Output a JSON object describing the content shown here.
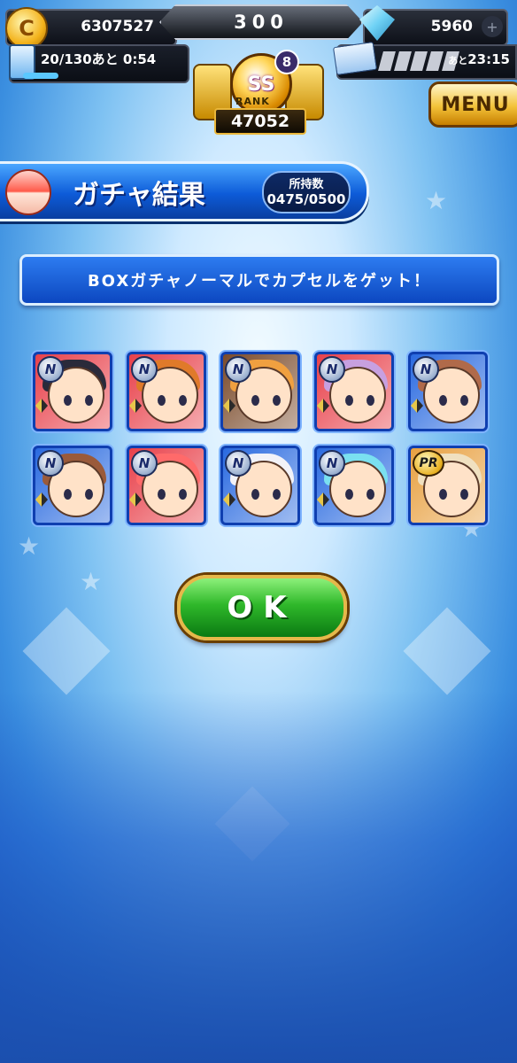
{
  "status_bar": {
    "coins": "6307527",
    "center_value": "300",
    "gems": "5960",
    "stamina": "20/130あと 0:54",
    "ticket_time_prefix": "あと",
    "ticket_time": "23:15",
    "rank_grade": "SS",
    "rank_level": "8",
    "rank_label": "RANK",
    "rank_points": "47052",
    "menu_label": "MENU"
  },
  "header": {
    "title": "ガチャ結果",
    "possession_label": "所持数",
    "possession_count": "0475/0500"
  },
  "message": "BOXガチャノーマルでカプセルをゲット！",
  "cards": [
    {
      "rarity": "N",
      "bg": "#e8404a",
      "hair": "#2a2a3a"
    },
    {
      "rarity": "N",
      "bg": "#e8404a",
      "hair": "#e07a2a"
    },
    {
      "rarity": "N",
      "bg": "#7a4a2a",
      "hair": "#f0a040"
    },
    {
      "rarity": "N",
      "bg": "#e8404a",
      "hair": "#c7a0e0"
    },
    {
      "rarity": "N",
      "bg": "#2a6ae0",
      "hair": "#b06a4a"
    },
    {
      "rarity": "N",
      "bg": "#2a6ae0",
      "hair": "#9a5a3a"
    },
    {
      "rarity": "N",
      "bg": "#e8404a",
      "hair": "#ff6a6a"
    },
    {
      "rarity": "N",
      "bg": "#2a6ae0",
      "hair": "#f2f2f8"
    },
    {
      "rarity": "N",
      "bg": "#2a6ae0",
      "hair": "#7ae0f0"
    },
    {
      "rarity": "PR",
      "bg": "#e8a040",
      "hair": "#f0e0c0"
    }
  ],
  "ok_label": "OK"
}
